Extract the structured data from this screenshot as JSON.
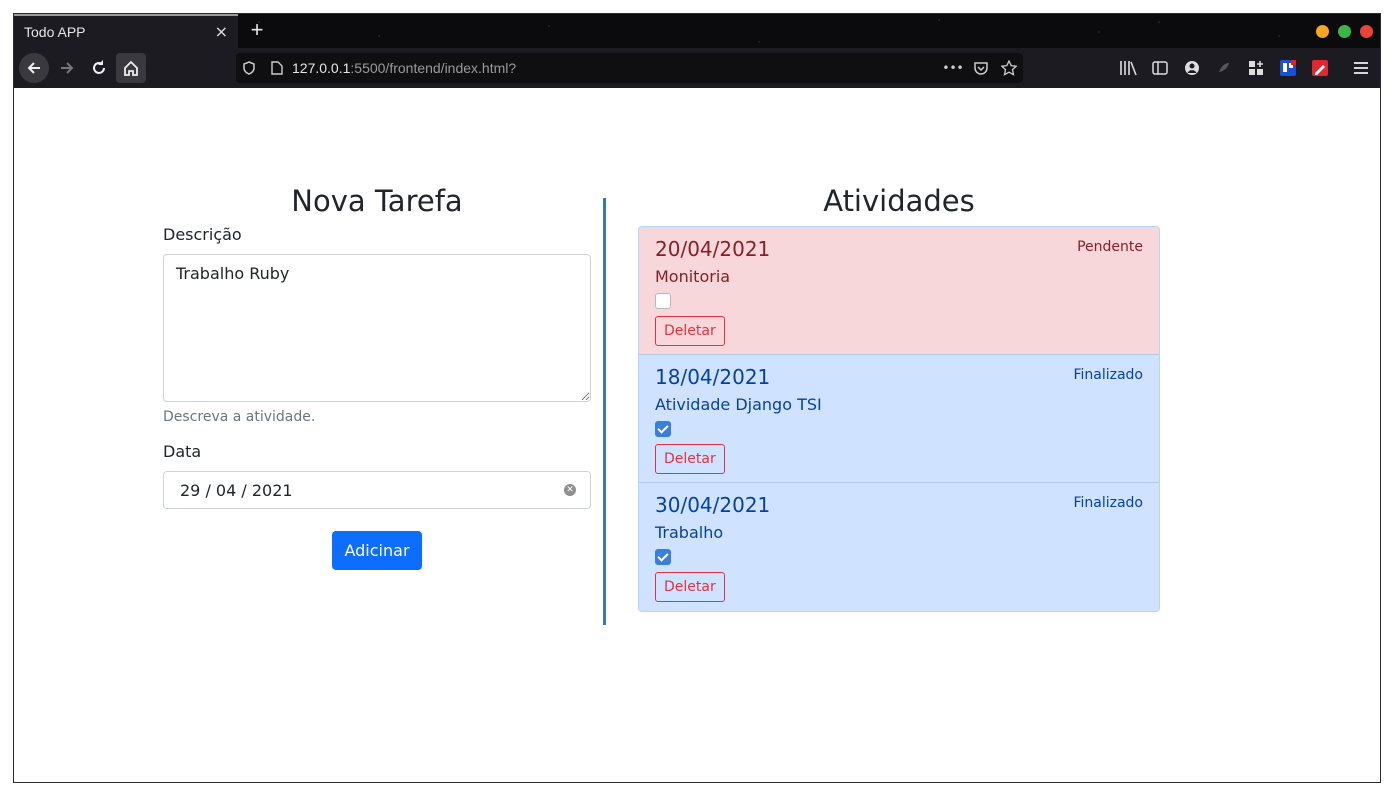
{
  "browser": {
    "tab_title": "Todo APP",
    "tab_close": "×",
    "new_tab": "+",
    "url_host": "127.0.0.1",
    "url_rest": ":5500/frontend/index.html?",
    "url_more": "•••",
    "traffic_colors": [
      "#f5a623",
      "#3bb54a",
      "#e9443b"
    ]
  },
  "form": {
    "title": "Nova Tarefa",
    "desc_label": "Descrição",
    "desc_value": "Trabalho Ruby",
    "desc_help": "Descreva a atividade.",
    "date_label": "Data",
    "date_value": "29 / 04 / 2021",
    "add_button": "Adicinar"
  },
  "activities": {
    "title": "Atividades",
    "items": [
      {
        "date": "20/04/2021",
        "status": "Pendente",
        "description": "Monitoria",
        "checked": false,
        "delete_label": "Deletar"
      },
      {
        "date": "18/04/2021",
        "status": "Finalizado",
        "description": "Atividade Django TSI",
        "checked": true,
        "delete_label": "Deletar"
      },
      {
        "date": "30/04/2021",
        "status": "Finalizado",
        "description": "Trabalho",
        "checked": true,
        "delete_label": "Deletar"
      }
    ]
  },
  "colors": {
    "primary": "#0d6efd",
    "danger": "#dc3545",
    "pending_bg": "#f8d7da",
    "done_bg": "#cfe2ff",
    "divider": "#2e7fa0"
  }
}
